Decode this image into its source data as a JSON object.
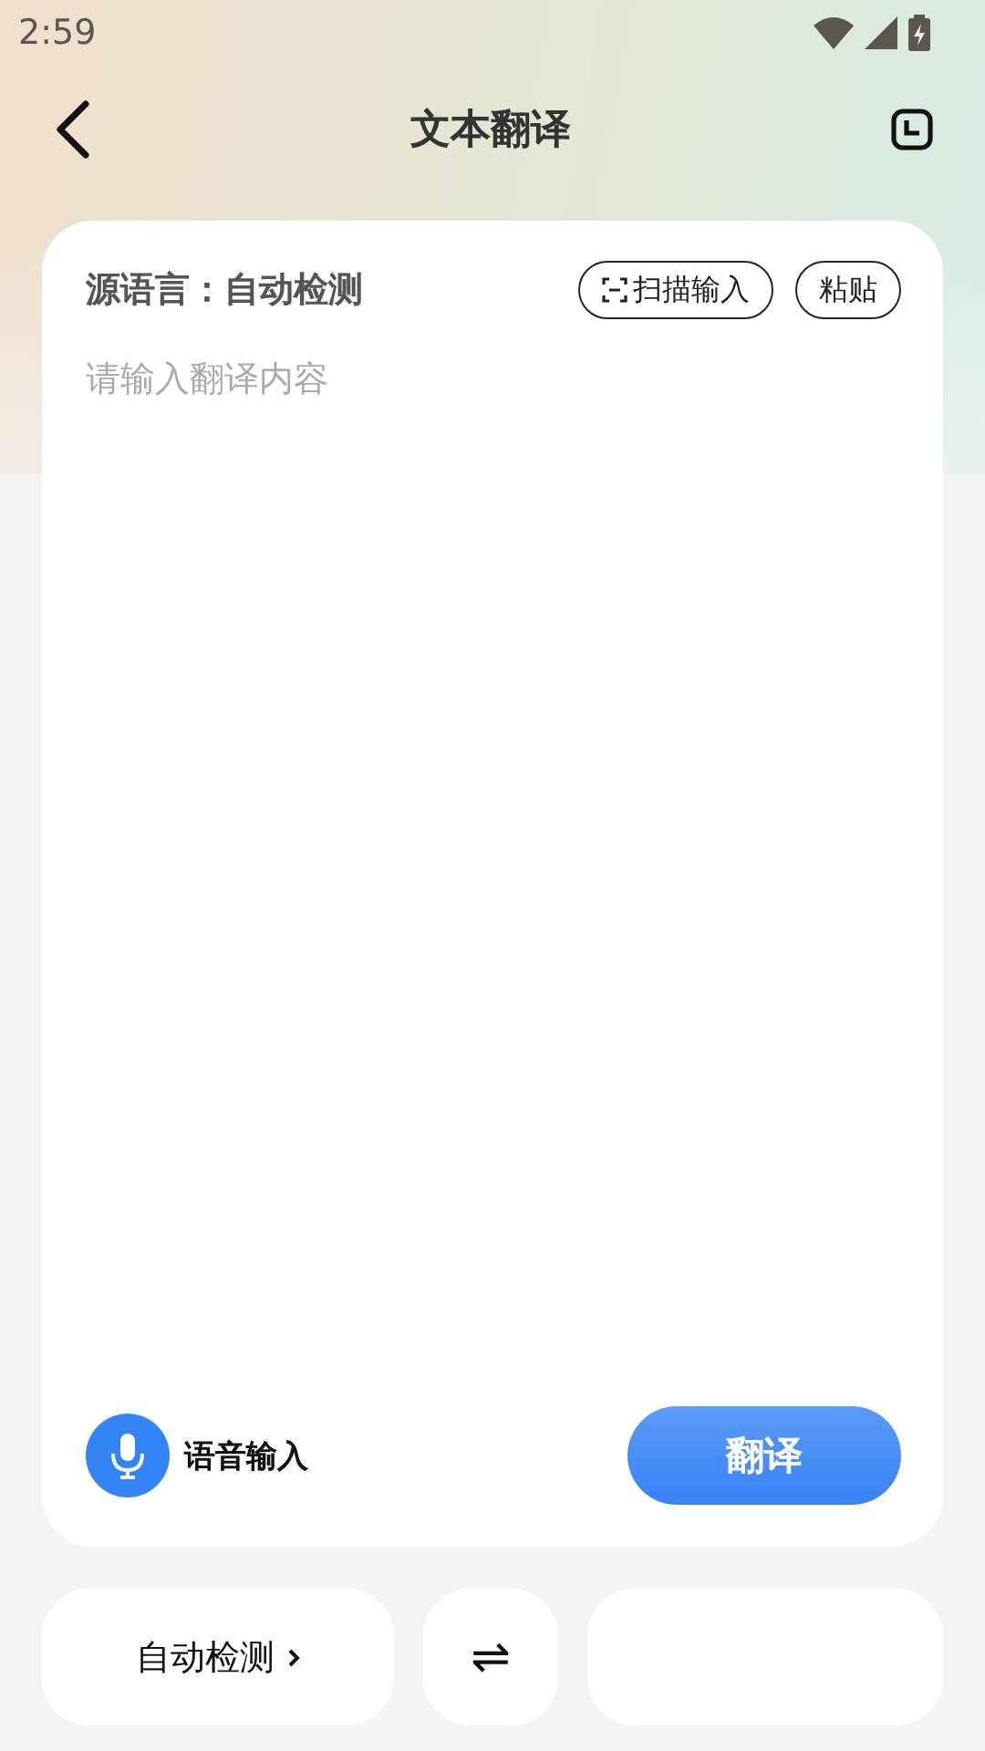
{
  "status_bar": {
    "time": "2:59"
  },
  "header": {
    "title": "文本翻译"
  },
  "card": {
    "source_label": "源语言：自动检测",
    "actions": [
      {
        "kind": "scan",
        "label": "扫描输入"
      },
      {
        "kind": "plain",
        "label": "粘贴"
      }
    ],
    "input": {
      "placeholder": "请输入翻译内容"
    },
    "voice": {
      "label": "语音输入"
    },
    "translate_button": "翻译"
  },
  "language_bar": {
    "source": "自动检测",
    "swap": "⇌"
  }
}
